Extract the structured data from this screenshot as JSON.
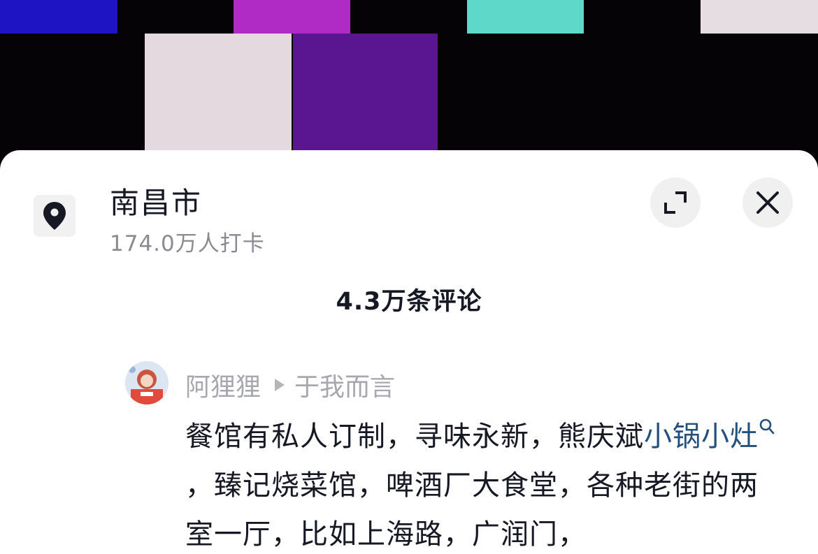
{
  "colors": {
    "link": "#24507e",
    "text_primary": "#161823",
    "text_secondary": "#8a8b91",
    "sheet_bg": "#ffffff"
  },
  "location": {
    "icon": "location-pin-icon",
    "name": "南昌市",
    "checkins": "174.0万人打卡"
  },
  "actions": {
    "expand_icon": "expand-icon",
    "close_icon": "close-icon"
  },
  "comments": {
    "count_label": "4.3万条评论",
    "items": [
      {
        "author": "阿狸狸",
        "reply_to": "于我而言",
        "text_before": "餐馆有私人订制，寻味永新，熊庆斌",
        "link_text": "小锅小灶",
        "text_after": "，臻记烧菜馆，啤酒厂大食堂，各种老街的两室一厅，比如上海路，广润门，"
      }
    ]
  }
}
